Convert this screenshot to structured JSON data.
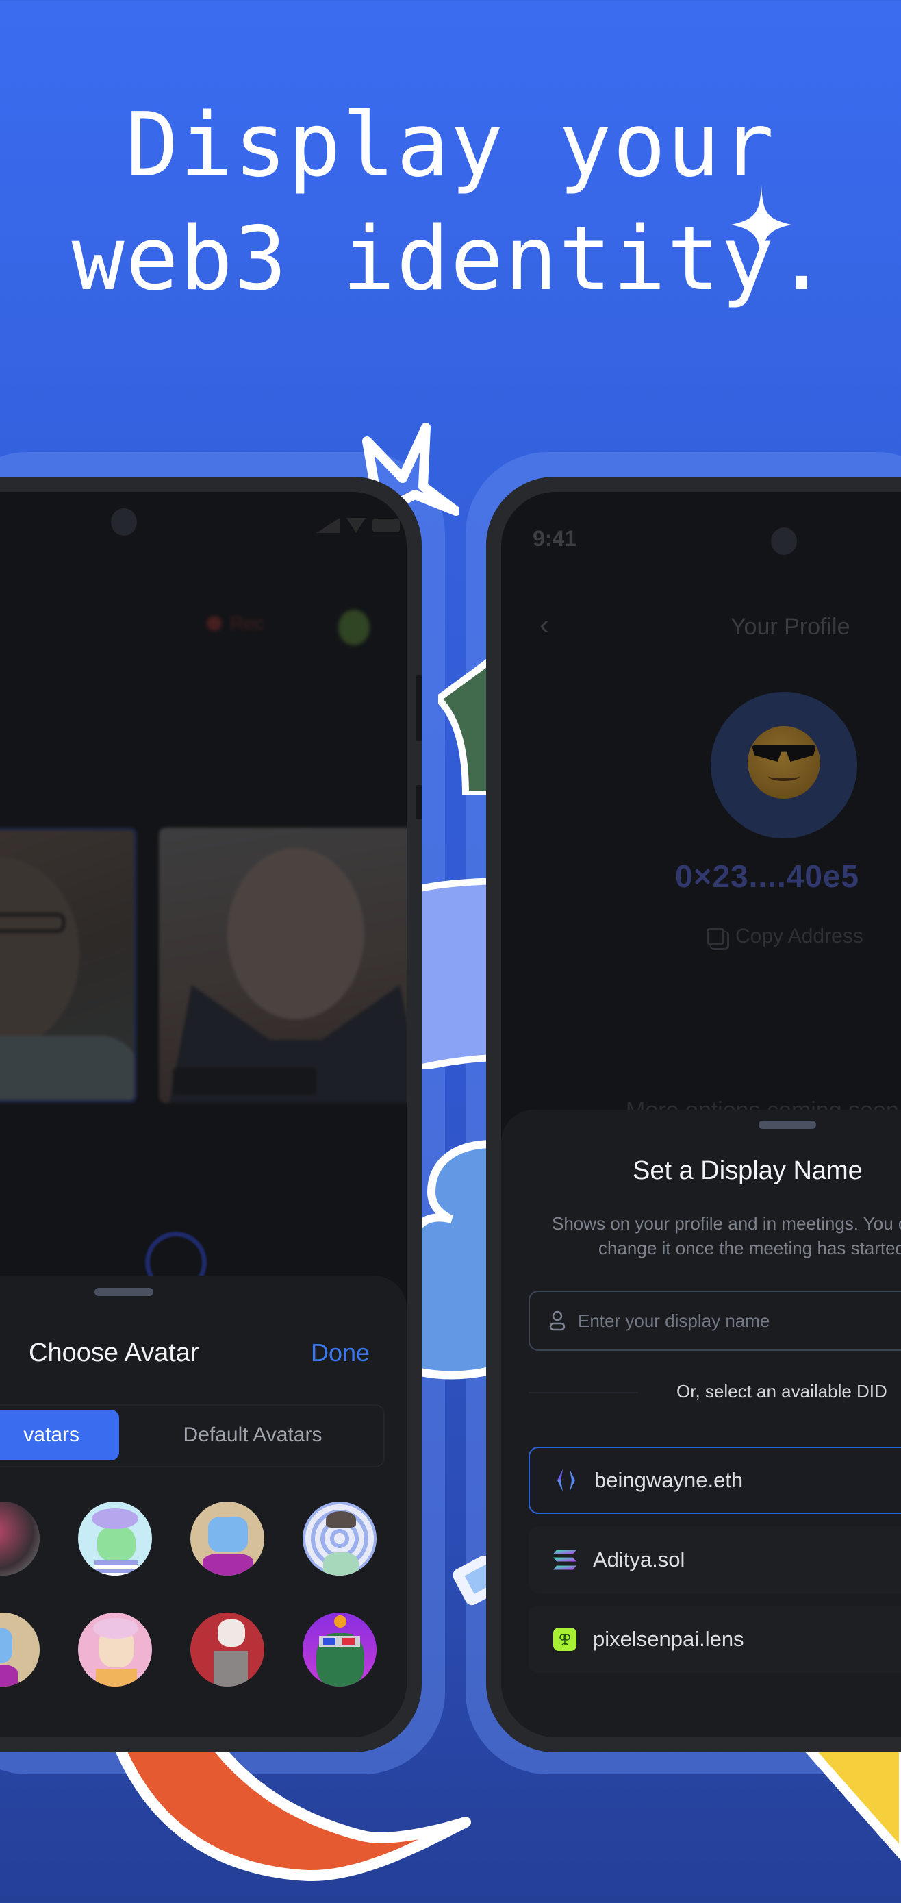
{
  "headline": {
    "line1": "Display your",
    "line2": "web3 identity."
  },
  "colors": {
    "accent": "#3a6cf0",
    "background_top": "#3b6cf0",
    "background_bottom": "#243f96",
    "screen_bg": "#131417",
    "sheet_bg": "#1b1c20",
    "selected_border": "#2e61d9"
  },
  "left_phone": {
    "status_bar": {
      "icons": [
        "signal-icon",
        "wifi-icon",
        "battery-icon"
      ]
    },
    "call_header": {
      "rec_label": "Rec",
      "rec_icon": "record-dot-icon"
    },
    "avatar_sheet": {
      "title": "Choose Avatar",
      "done_label": "Done",
      "tabs": [
        {
          "label": "NFT Avatars",
          "visible_label": "vatars",
          "active": true
        },
        {
          "label": "Default Avatars",
          "active": false
        }
      ],
      "avatars": [
        {
          "name": "red-haired-character"
        },
        {
          "name": "green-mouse-with-glasses"
        },
        {
          "name": "blue-cat-purple-hoodie"
        },
        {
          "name": "character-with-cap"
        },
        {
          "name": "blue-cat-purple-hoodie-2"
        },
        {
          "name": "pink-haired-girl"
        },
        {
          "name": "fox-mask-character"
        },
        {
          "name": "green-dragon-3d-glasses"
        }
      ]
    }
  },
  "right_phone": {
    "status_bar": {
      "time": "9:41"
    },
    "nav": {
      "title": "Your Profile",
      "back_icon": "chevron-left-icon"
    },
    "profile": {
      "avatar_emoji": "😎",
      "address": "0×23....40e5",
      "more_icon": "kebab-menu-icon",
      "copy_label": "Copy Address",
      "more_options": "More options coming soon"
    },
    "display_name_sheet": {
      "title": "Set a Display Name",
      "subtitle_line1": "Shows on your profile and in meetings. You can't",
      "subtitle_line2": "change it once the meeting has started.",
      "input_placeholder": "Enter your display name",
      "input_value": "",
      "or_text": "Or, select an available DID",
      "did_options": [
        {
          "label": "beingwayne.eth",
          "icon": "ens-icon",
          "selected": true
        },
        {
          "label": "Aditya.sol",
          "icon": "solana-icon",
          "selected": false
        },
        {
          "label": "pixelsenpai.lens",
          "icon": "lens-icon",
          "selected": false
        }
      ]
    }
  }
}
